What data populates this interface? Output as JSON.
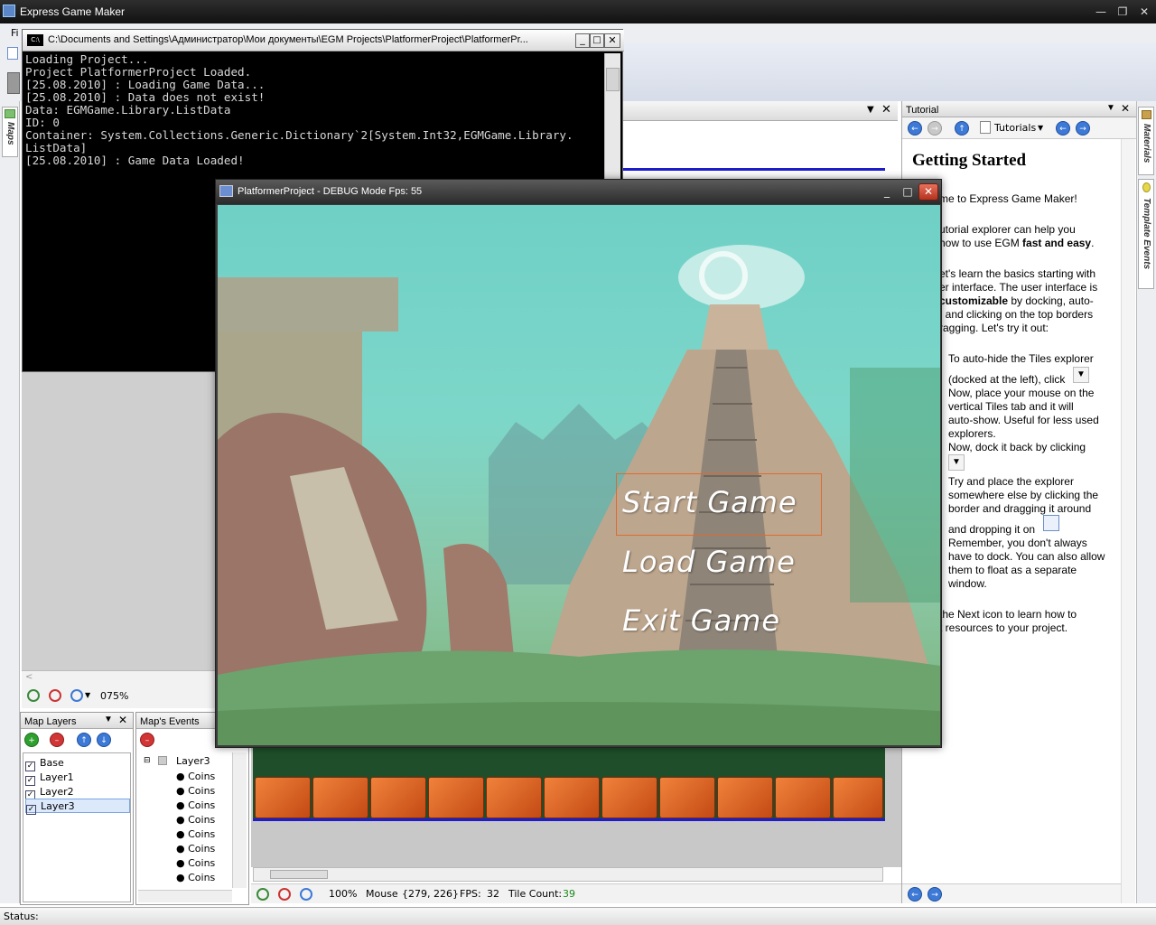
{
  "app": {
    "title": "Express Game Maker"
  },
  "console": {
    "title": "C:\\Documents and Settings\\Администратор\\Мои документы\\EGM Projects\\PlatformerProject\\PlatformerPr...",
    "lines": "Loading Project...\nProject PlatformerProject Loaded.\n[25.08.2010] : Loading Game Data...\n[25.08.2010] : Data does not exist!\nData: EGMGame.Library.ListData\nID: 0\nContainer: System.Collections.Generic.Dictionary`2[System.Int32,EGMGame.Library.\nListData]\n[25.08.2010] : Game Data Loaded!"
  },
  "game": {
    "title": "PlatformerProject - DEBUG Mode Fps: 55",
    "menu": [
      "Start Game",
      "Load Game",
      "Exit Game"
    ]
  },
  "left_tabs": {
    "maps": "Maps",
    "menu_f": "Fi"
  },
  "right_tabs": {
    "materials": "Materials",
    "template_events": "Template Events"
  },
  "tutorial": {
    "header": "Tutorial",
    "toolbar_label": "Tutorials",
    "heading": "Getting Started",
    "p1": "me to Express Game Maker!",
    "p2a": "utorial explorer can help you",
    "p2b": "how to use EGM ",
    "p2bold": "fast and easy",
    "p2end": ".",
    "p3a": "et's learn the basics starting with",
    "p3b": "er interface. The user interface is",
    "p3bold": "customizable",
    "p3c": " by docking, auto-",
    "p3d": ", and clicking on the top borders",
    "p3e": "ragging. Let's try it out:",
    "s1": "To auto-hide the Tiles explorer",
    "s2": "(docked at the left), click",
    "s3": "Now, place your mouse on the",
    "s4": "vertical Tiles tab and it will",
    "s5": "auto-show. Useful for less used",
    "s6": "explorers.",
    "s7": "Now, dock it back by clicking",
    "s8": "Try and place the explorer",
    "s9": "somewhere else by clicking the",
    "s10": "border and dragging it around",
    "s11": "and dropping it on",
    "s12": "Remember, you don't always",
    "s13": "have to dock. You can also allow",
    "s14": "them to float as a separate",
    "s15": "window.",
    "p4a": "the Next icon to learn how to",
    "p4b": "t resources to your project."
  },
  "zoom_left": {
    "value": "075%"
  },
  "map_layers": {
    "header": "Map Layers",
    "items": [
      {
        "label": "Base",
        "checked": true
      },
      {
        "label": "Layer1",
        "checked": true
      },
      {
        "label": "Layer2",
        "checked": true
      },
      {
        "label": "Layer3",
        "checked": true
      }
    ]
  },
  "map_events": {
    "header": "Map's Events",
    "root": "Layer3",
    "items": [
      "Coins",
      "Coins",
      "Coins",
      "Coins",
      "Coins",
      "Coins",
      "Coins",
      "Coins"
    ]
  },
  "bottom_status": {
    "zoom": "100%",
    "mouse_label": "Mouse",
    "mouse_value": "{279, 226}",
    "fps_label": "FPS:",
    "fps_value": "32",
    "tile_label": "Tile Count:",
    "tile_value": "39"
  },
  "statusbar": {
    "label": "Status:"
  },
  "colors": {
    "accent": "#3d79d6",
    "tile_count": "#1a8a1a",
    "selection": "#e06a2e"
  }
}
